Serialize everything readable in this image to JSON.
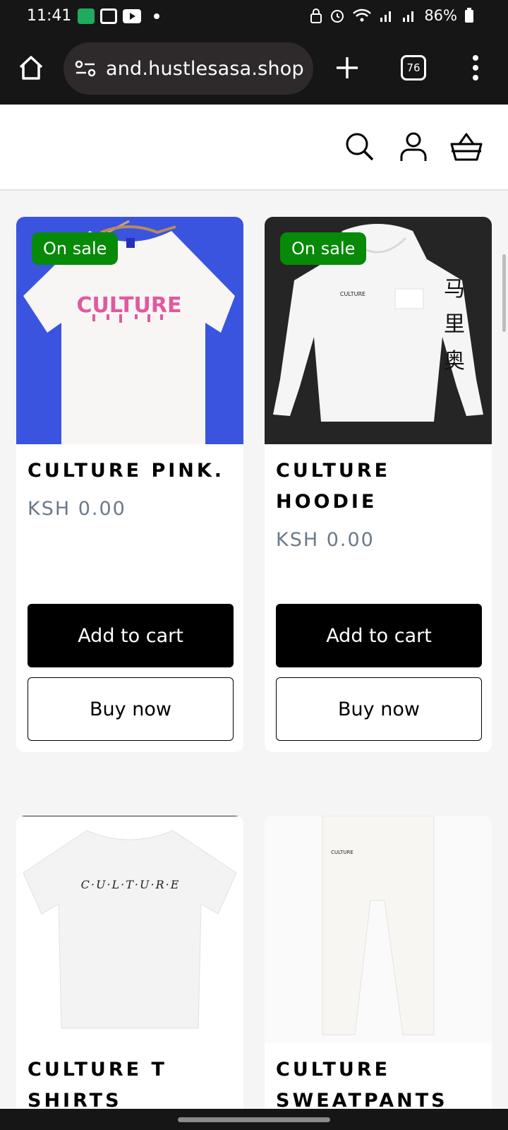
{
  "status_bar": {
    "time": "11:41",
    "battery": "86%",
    "left_icons": [
      "payment-app-icon",
      "news-icon",
      "youtube-icon",
      "dot-icon"
    ],
    "right_icons": [
      "lock-icon",
      "alarm-icon",
      "wifi-icon",
      "signal-icon",
      "signal-icon",
      "battery-icon"
    ]
  },
  "browser": {
    "url": "and.hustlesasa.shop",
    "tab_count": "76"
  },
  "header": {
    "icons": [
      "search-icon",
      "account-icon",
      "basket-icon"
    ]
  },
  "products": [
    {
      "title": "CULTURE PINK.",
      "price": "KSH 0.00",
      "badge": "On sale",
      "add_to_cart": "Add to cart",
      "buy_now": "Buy now",
      "print_text": "CULTURE",
      "image_bg": "#3a54e0"
    },
    {
      "title": "CULTURE HOODIE",
      "price": "KSH 0.00",
      "badge": "On sale",
      "add_to_cart": "Add to cart",
      "buy_now": "Buy now",
      "print_text": "CULTURE",
      "sleeve_text": "马\n里\n奥",
      "image_bg": "#252525"
    },
    {
      "title": "CULTURE T SHIRTS",
      "print_text": "C·U·L·T·U·R·E"
    },
    {
      "title": "CULTURE SWEATPANTS",
      "print_text": "CULTURE"
    }
  ],
  "colors": {
    "sale_green": "#078a07",
    "price_gray": "#6b7a88",
    "dark_chrome": "#161616"
  }
}
